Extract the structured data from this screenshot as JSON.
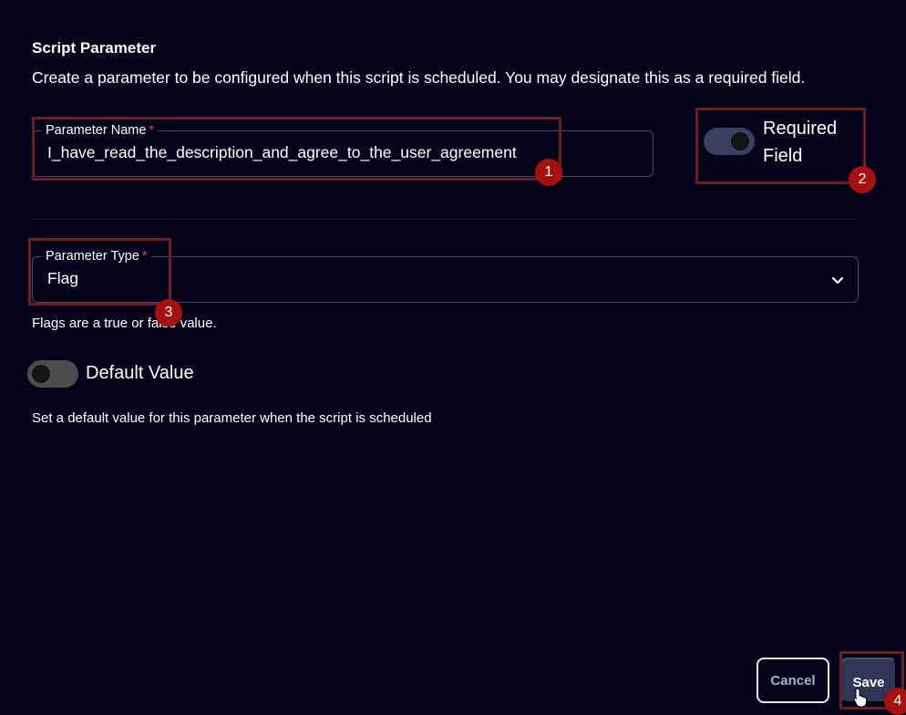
{
  "header": {
    "title": "Script Parameter",
    "description": "Create a parameter to be configured when this script is scheduled. You may designate this as a required field."
  },
  "parameter_name": {
    "label": "Parameter Name",
    "required_marker": "*",
    "value": "I_have_read_the_description_and_agree_to_the_user_agreement"
  },
  "required_field": {
    "label_line1": "Required",
    "label_line2": "Field",
    "enabled": true
  },
  "parameter_type": {
    "label": "Parameter Type",
    "required_marker": "*",
    "value": "Flag",
    "hint": "Flags are a true or false value."
  },
  "default_value": {
    "label": "Default Value",
    "enabled": false,
    "hint": "Set a default value for this parameter when the script is scheduled"
  },
  "actions": {
    "cancel_label": "Cancel",
    "save_label": "Save"
  },
  "annotations": {
    "badge_1": "1",
    "badge_2": "2",
    "badge_3": "3",
    "badge_4": "4",
    "color": "#a51010"
  },
  "icons": {
    "type_dropdown": "chevron-down-icon",
    "pointer": "hand-pointer-icon"
  },
  "colors": {
    "background": "#03031a",
    "toggle_on": "#3a4060",
    "toggle_off": "#4d4d4d",
    "required_marker": "#e04a4a",
    "save_button": "#2f3555"
  }
}
